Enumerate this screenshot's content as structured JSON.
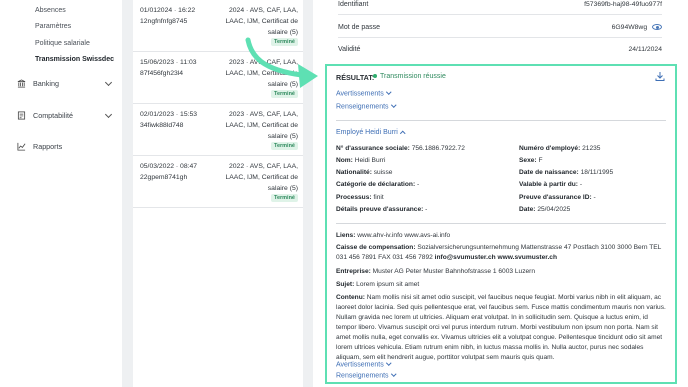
{
  "sidebar": {
    "sub_items": [
      "Absences",
      "Paramètres",
      "Politique salariale",
      "Transmission Swissdec"
    ],
    "main_items": [
      {
        "label": "Banking",
        "icon": "bank-icon",
        "has_chevron": true
      },
      {
        "label": "Comptabilité",
        "icon": "ledger-icon",
        "has_chevron": true
      },
      {
        "label": "Rapports",
        "icon": "chart-icon",
        "has_chevron": false
      }
    ]
  },
  "list": {
    "rows": [
      {
        "date": "01/012024 · 16:22",
        "id": "12ngfnfnfg8745",
        "desc": "2024 · AVS, CAF, LAA, LAAC, IJM, Certificat de salaire (5)",
        "status": "Terminé"
      },
      {
        "date": "15/06/2023 · 11:03",
        "id": "87f456fgh23l4",
        "desc": "2023 · AVS, CAF, LAA, LAAC, IJM, Certificat de salaire (5)",
        "status": "Terminé"
      },
      {
        "date": "02/01/2023 · 15:53",
        "id": "34fiwk88ld748",
        "desc": "2023 · AVS, CAF, LAA, LAAC, IJM, Certificat de salaire (5)",
        "status": "Terminé"
      },
      {
        "date": "05/03/2022 · 08:47",
        "id": "22gpem8741gh",
        "desc": "2022 · AVS, CAF, LAA, LAAC, IJM, Certificat de salaire (5)",
        "status": "Terminé"
      }
    ]
  },
  "panel": {
    "identifiant_label": "Identifiant",
    "identifiant_value": "f57369fb-haj98-49fuo977f",
    "password_label": "Mot de passe",
    "password_value": "6G94W8wg",
    "validity_label": "Validité",
    "validity_value": "24/11/2024"
  },
  "result": {
    "title": "RÉSULTAT:",
    "status": "Transmission réussie",
    "warnings_label": "Avertissements",
    "info_label": "Renseignements",
    "employee_label": "Employé Heidi Burri",
    "fields_left": [
      {
        "k": "N° d'assurance sociale:",
        "v": "756.1886.7922.72"
      },
      {
        "k": "Nom:",
        "v": "Heidi Burri"
      },
      {
        "k": "Nationalité:",
        "v": "suisse"
      },
      {
        "k": "Catégorie de déclaration:",
        "v": "-"
      },
      {
        "k": "Processus:",
        "v": "finit"
      },
      {
        "k": "Détails preuve d'assurance:",
        "v": "-"
      }
    ],
    "fields_right": [
      {
        "k": "Numéro d'employé:",
        "v": "21235"
      },
      {
        "k": "Sexe:",
        "v": "F"
      },
      {
        "k": "Date de naissance:",
        "v": "18/11/1995"
      },
      {
        "k": "Valable à partir du:",
        "v": "-"
      },
      {
        "k": "Preuve d'assurance ID:",
        "v": "-"
      },
      {
        "k": "Date:",
        "v": "25/04/2025"
      }
    ],
    "links_label": "Liens:",
    "links_value": "www.ahv-iv.info    www.avs-ai.info",
    "caisse_label": "Caisse de compensation:",
    "caisse_value": "Sozialversicherungsunternehmung Mattenstrasse 47 Postfach 3100 3000 Bern TEL 031 456 7891 FAX 031 456 7892",
    "caisse_bold": "info@svumuster.ch www.svumuster.ch",
    "entreprise_label": "Entreprise:",
    "entreprise_value": "Muster AG Peter Muster Bahnhofstrasse 1 6003 Luzern",
    "sujet_label": "Sujet:",
    "sujet_value": "Lorem ipsum sit amet",
    "contenu_label": "Contenu:",
    "contenu_value": "Nam mollis nisi sit amet odio suscipit, vel faucibus neque feugiat. Morbi varius nibh in elit aliquam, ac laoreet dolor lacinia. Sed quis pellentesque erat, vel faucibus sem. Fusce mattis condimentum mauris non varius. Nullam gravida nec lorem ut ultricies. Aliquam erat volutpat. In in sollicitudin sem. Quisque a luctus enim, id tempor libero. Vivamus suscipit orci vel purus interdum rutrum. Morbi vestibulum non ipsum non porta. Nam sit amet mollis nulla, eget convallis ex. Vivamus ultricies elit a volutpat congue. Pellentesque tincidunt odio sit amet lorem ultrices vehicula. Etiam rutrum enim nibh, in luctus massa mollis in. Nulla auctor, purus nec sodales aliquam, sem elit hendrerit augue, porttitor volutpat sem mauris quis quam.",
    "warnings_label_2": "Avertissements",
    "info_label_2": "Renseignements"
  },
  "colors": {
    "accent_border": "#5ee0b3",
    "link": "#3f6fb5",
    "success": "#2f8a5e"
  }
}
